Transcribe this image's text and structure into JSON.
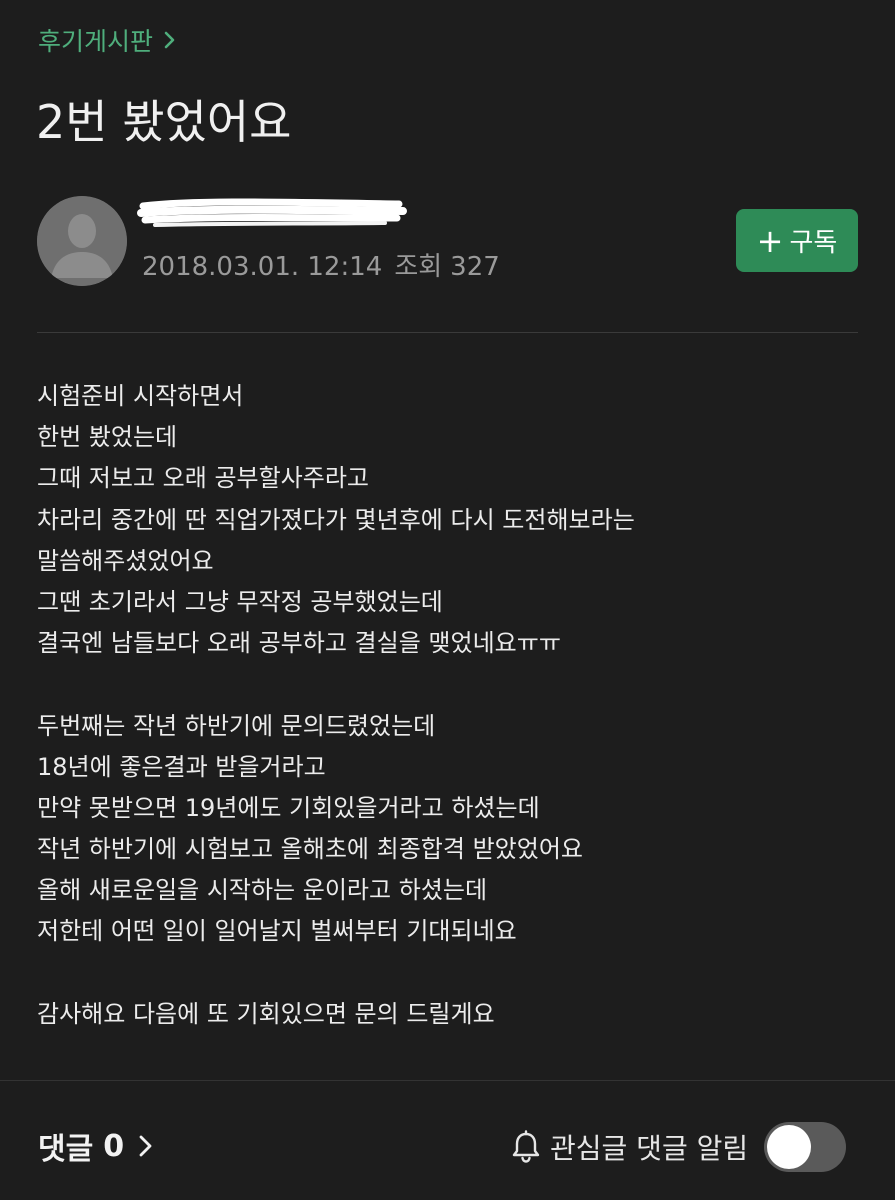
{
  "header": {
    "board_name": "후기게시판",
    "post_title": "2번 봤었어요"
  },
  "author": {
    "name": "",
    "date": "2018.03.01. 12:14",
    "views_label": "조회",
    "views_count": "327",
    "subscribe_label": "구독",
    "subscribe_icon": "plus-icon"
  },
  "post_body": {
    "paragraphs": [
      [
        "시험준비 시작하면서",
        "한번 봤었는데",
        "그때 저보고 오래 공부할사주라고",
        "차라리 중간에 딴 직업가졌다가 몇년후에 다시 도전해보라는",
        "말씀해주셨었어요",
        "그땐 초기라서 그냥 무작정 공부했었는데",
        "결국엔 남들보다 오래 공부하고 결실을 맺었네요ㅠㅠ"
      ],
      [
        "두번째는 작년 하반기에 문의드렸었는데",
        "18년에 좋은결과 받을거라고",
        "만약 못받으면 19년에도 기회있을거라고 하셨는데",
        "작년 하반기에 시험보고 올해초에 최종합격 받았었어요",
        "올해 새로운일을 시작하는 운이라고 하셨는데",
        "저한테 어떤 일이 일어날지 벌써부터 기대되네요"
      ],
      [
        "감사해요 다음에 또 기회있으면 문의 드릴게요"
      ]
    ]
  },
  "footer": {
    "comments_label": "댓글",
    "comments_count": "0",
    "notify_label": "관심글 댓글 알림",
    "notify_icon": "bell-icon",
    "notify_enabled": false
  },
  "colors": {
    "background": "#1d1d1d",
    "accent_green": "#4fae7c",
    "button_green": "#2e8b57",
    "meta_gray": "#9a9a9a"
  }
}
